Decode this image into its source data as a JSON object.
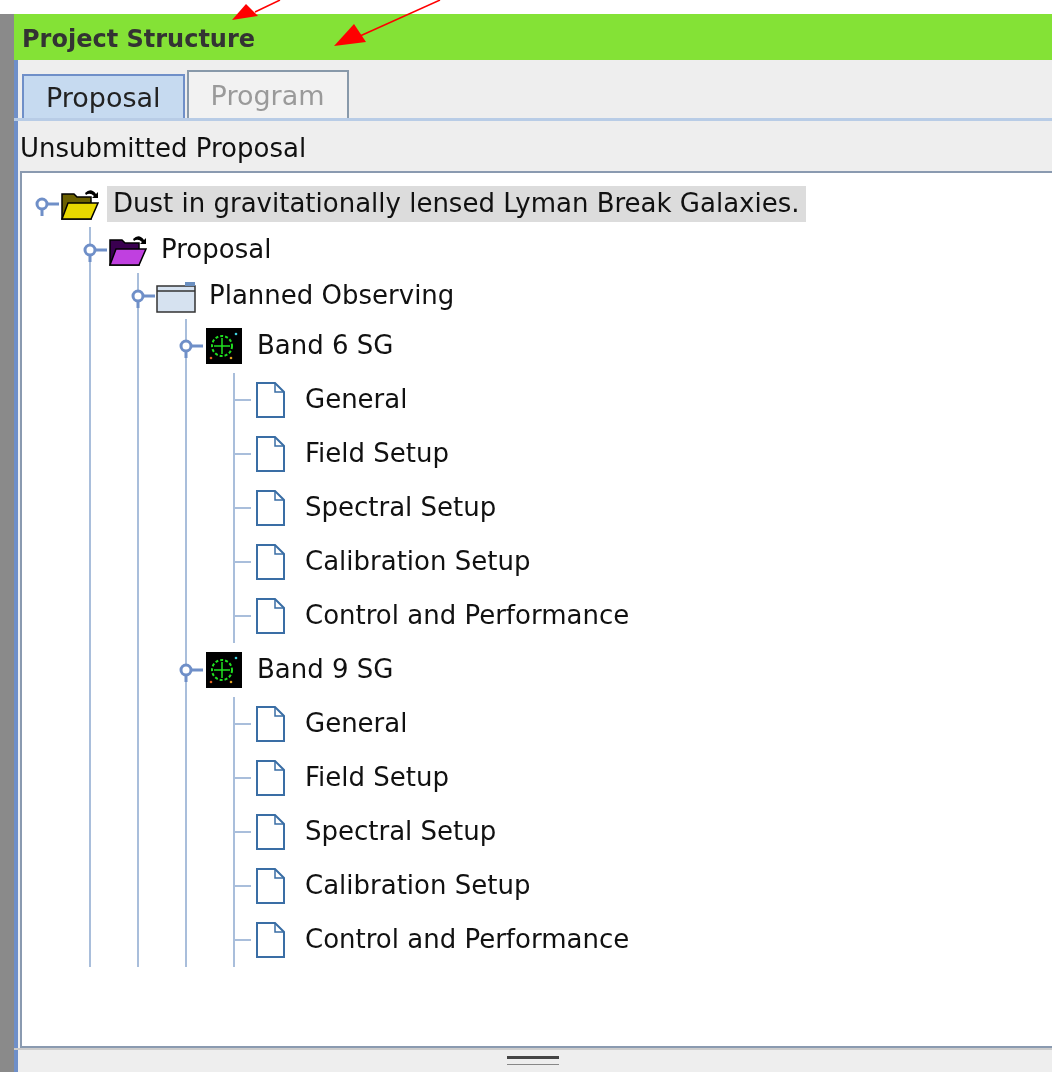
{
  "panel": {
    "title": "Project Structure"
  },
  "tabs": [
    {
      "label": "Proposal",
      "selected": true
    },
    {
      "label": "Program",
      "selected": false
    }
  ],
  "status_label": "Unsubmitted Proposal",
  "tree": [
    {
      "label": "Dust in gravitationally lensed Lyman Break Galaxies.",
      "kind": "root",
      "selected": true,
      "expanded": true,
      "children": [
        {
          "label": "Proposal",
          "kind": "proposal",
          "selected": false,
          "expanded": true,
          "children": [
            {
              "label": "Planned Observing",
              "kind": "folder",
              "selected": false,
              "expanded": true,
              "children": [
                {
                  "label": "Band 6 SG",
                  "kind": "target",
                  "selected": false,
                  "expanded": true,
                  "children": [
                    {
                      "label": "General",
                      "kind": "page",
                      "selected": false
                    },
                    {
                      "label": "Field Setup",
                      "kind": "page",
                      "selected": false
                    },
                    {
                      "label": "Spectral Setup",
                      "kind": "page",
                      "selected": false
                    },
                    {
                      "label": "Calibration Setup",
                      "kind": "page",
                      "selected": false
                    },
                    {
                      "label": "Control and Performance",
                      "kind": "page",
                      "selected": false
                    }
                  ]
                },
                {
                  "label": "Band 9 SG",
                  "kind": "target",
                  "selected": false,
                  "expanded": true,
                  "children": [
                    {
                      "label": "General",
                      "kind": "page",
                      "selected": false
                    },
                    {
                      "label": "Field Setup",
                      "kind": "page",
                      "selected": false
                    },
                    {
                      "label": "Spectral Setup",
                      "kind": "page",
                      "selected": false
                    },
                    {
                      "label": "Calibration Setup",
                      "kind": "page",
                      "selected": false
                    },
                    {
                      "label": "Control and Performance",
                      "kind": "page",
                      "selected": false
                    }
                  ]
                }
              ]
            }
          ]
        }
      ]
    }
  ]
}
